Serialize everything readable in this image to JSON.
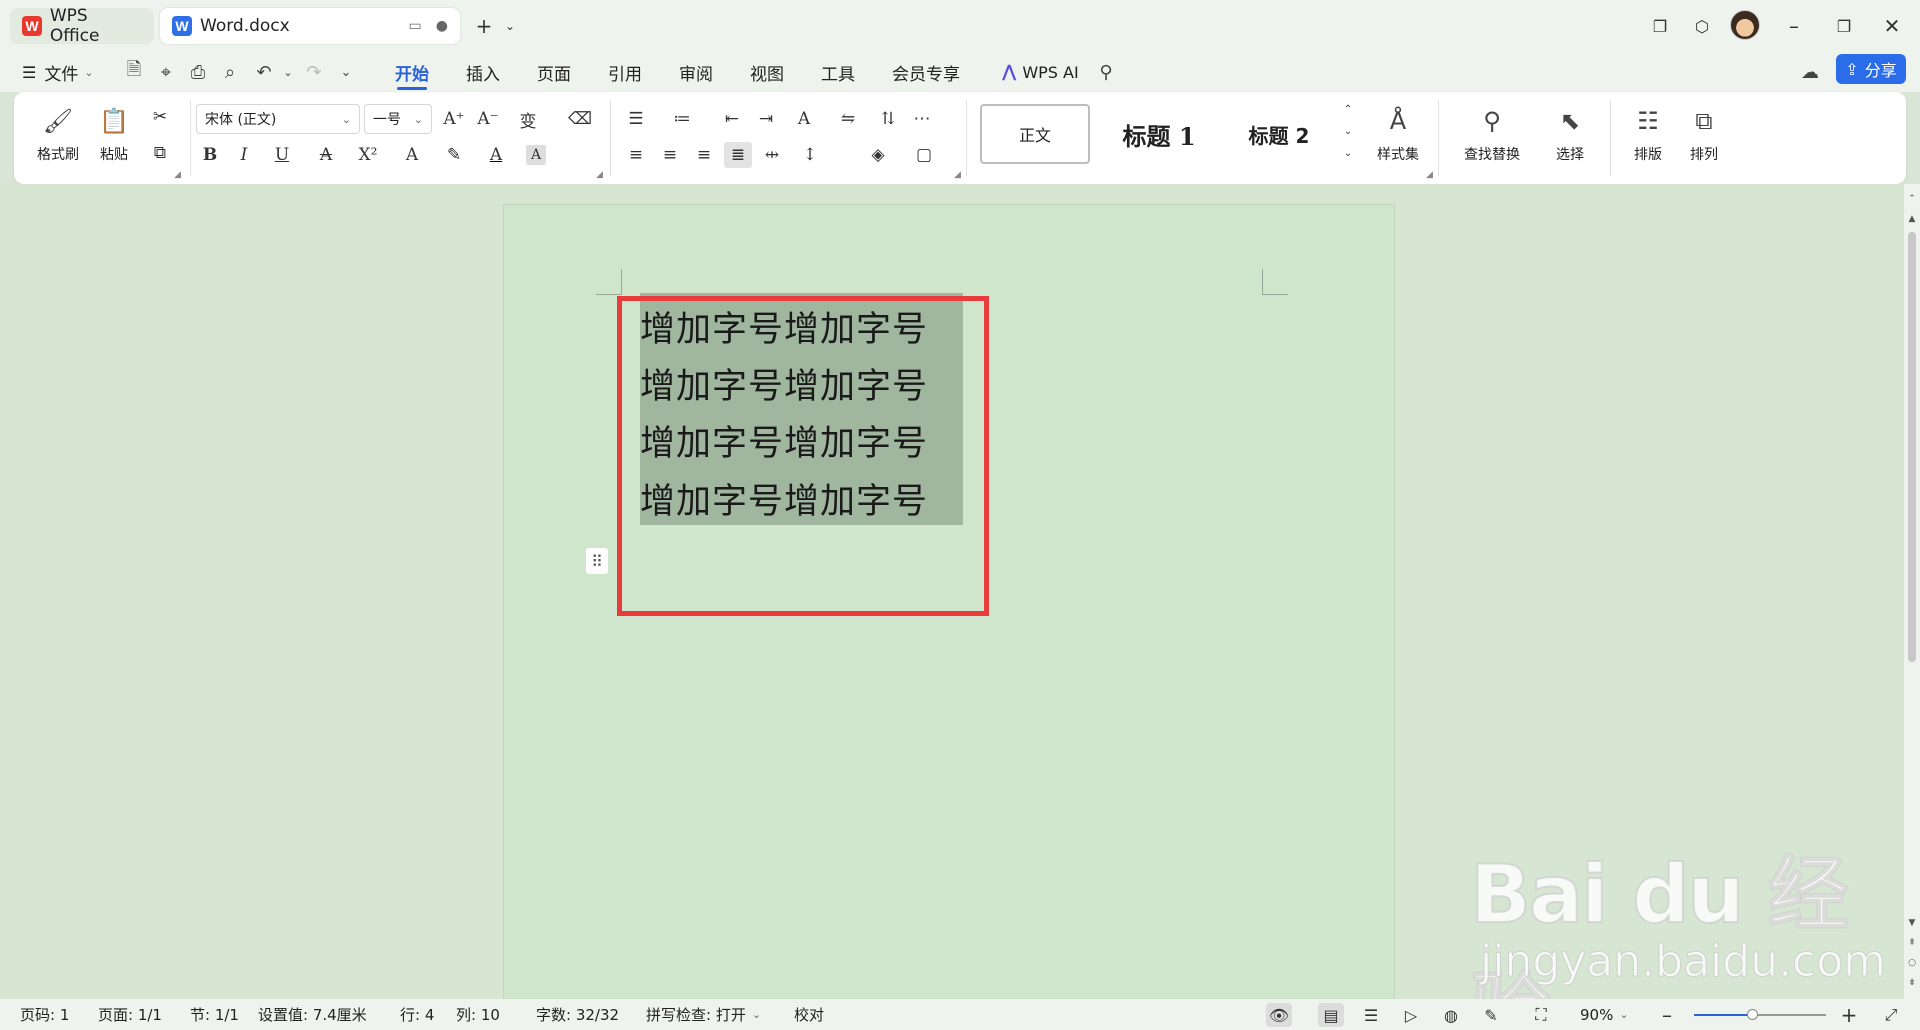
{
  "tabs": {
    "home_label": "WPS Office",
    "doc_label": "Word.docx"
  },
  "menu": {
    "file_label": "文件",
    "tabs": [
      "开始",
      "插入",
      "页面",
      "引用",
      "审阅",
      "视图",
      "工具",
      "会员专享"
    ],
    "ai_label": "WPS AI",
    "share_label": "分享"
  },
  "ribbon": {
    "format_painter": "格式刷",
    "paste": "粘贴",
    "font_name": "宋体 (正文)",
    "font_size": "一号",
    "styles": [
      "正文",
      "标题 1",
      "标题 2"
    ],
    "style_set": "样式集",
    "find_replace": "查找替换",
    "select": "选择",
    "layout": "排版",
    "arrange": "排列"
  },
  "document": {
    "lines": [
      "增加字号增加字号",
      "增加字号增加字号",
      "增加字号增加字号",
      "增加字号增加字号"
    ]
  },
  "status": {
    "page_num": "页码: 1",
    "pages": "页面: 1/1",
    "section": "节: 1/1",
    "position": "设置值: 7.4厘米",
    "row": "行: 4",
    "col": "列: 10",
    "word_count": "字数: 32/32",
    "spell_check": "拼写检查: 打开",
    "proofread": "校对",
    "zoom": "90%",
    "zoom_level": 0.45
  },
  "watermark": {
    "main": "Bai du 经验",
    "sub": "jingyan.baidu.com"
  },
  "colors": {
    "accent": "#2962d9",
    "highlight_border": "#e83b3b",
    "selection": "#a0b69f"
  }
}
